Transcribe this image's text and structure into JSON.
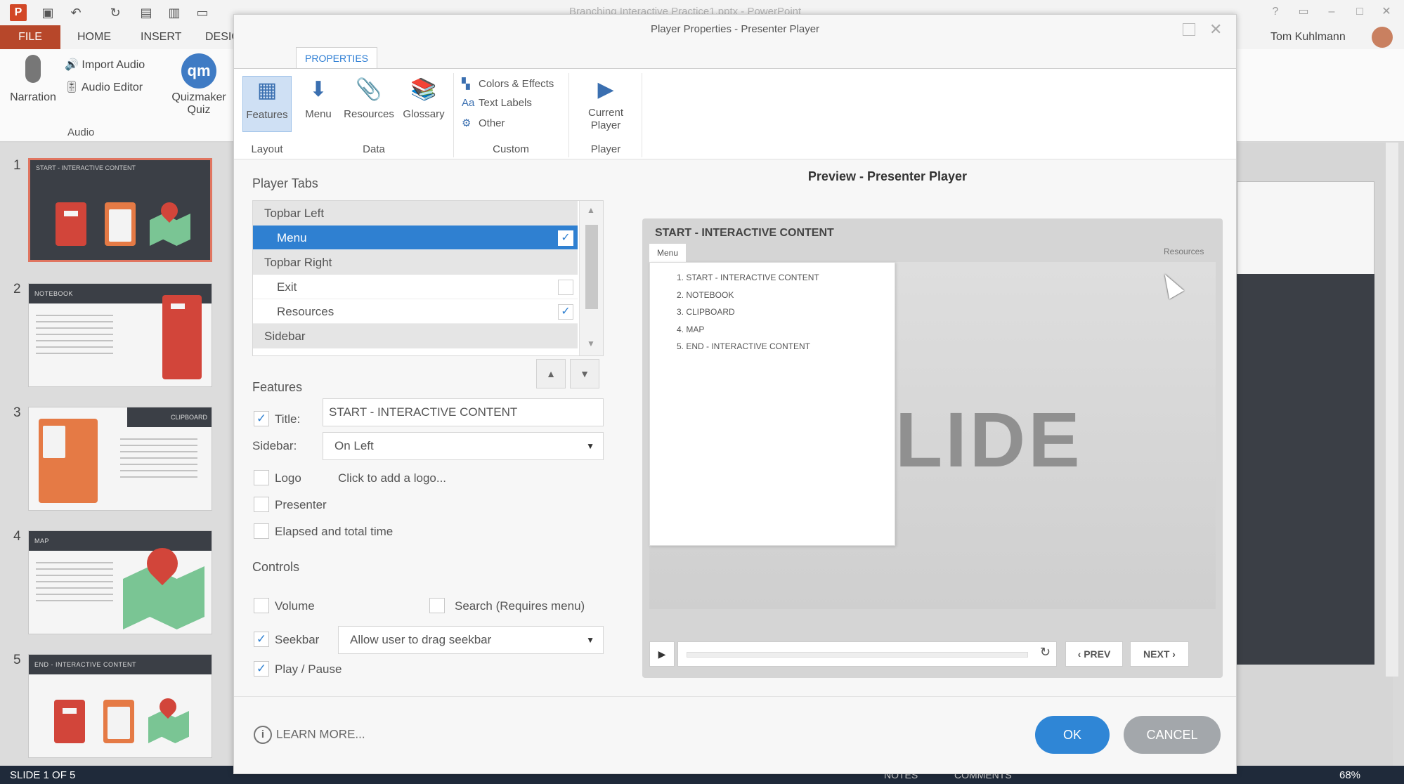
{
  "ppt": {
    "title": "Branching Interactive Practice1.pptx - PowerPoint",
    "file_tab": "FILE",
    "tabs": [
      "HOME",
      "INSERT",
      "DESIG"
    ],
    "user": "Tom Kuhlmann",
    "ribbon": {
      "narration": "Narration",
      "import_audio": "Import Audio",
      "audio_editor": "Audio Editor",
      "quizmaker_line1": "Quizmaker",
      "quizmaker_line2": "Quiz",
      "audio_group": "Audio",
      "qm_icon_text": "qm"
    },
    "thumbnails": [
      {
        "num": "1",
        "title": "START - INTERACTIVE CONTENT"
      },
      {
        "num": "2",
        "title": "NOTEBOOK"
      },
      {
        "num": "3",
        "title": "CLIPBOARD"
      },
      {
        "num": "4",
        "title": "MAP"
      },
      {
        "num": "5",
        "title": "END - INTERACTIVE CONTENT"
      }
    ],
    "status": {
      "slide": "SLIDE 1 OF 5",
      "notes": "NOTES",
      "comments": "COMMENTS",
      "zoom": "68%"
    }
  },
  "dialog": {
    "title": "Player Properties - Presenter Player",
    "ribbon_tab": "PROPERTIES",
    "ribbon": {
      "features": "Features",
      "menu": "Menu",
      "resources": "Resources",
      "glossary": "Glossary",
      "colors_effects": "Colors & Effects",
      "text_labels": "Text Labels",
      "other": "Other",
      "current_player_line1": "Current",
      "current_player_line2": "Player",
      "groups": {
        "layout": "Layout",
        "data": "Data",
        "custom": "Custom",
        "player": "Player"
      }
    },
    "player_tabs": {
      "label": "Player Tabs",
      "rows": [
        {
          "label": "Topbar Left",
          "type": "group"
        },
        {
          "label": "Menu",
          "type": "item",
          "checked": true,
          "selected": true
        },
        {
          "label": "Topbar Right",
          "type": "group"
        },
        {
          "label": "Exit",
          "type": "item",
          "checked": false
        },
        {
          "label": "Resources",
          "type": "item",
          "checked": true
        },
        {
          "label": "Sidebar",
          "type": "group"
        }
      ]
    },
    "features": {
      "label": "Features",
      "title_label": "Title:",
      "title_value": "START - INTERACTIVE CONTENT",
      "sidebar_label": "Sidebar:",
      "sidebar_value": "On Left",
      "logo_label": "Logo",
      "logo_placeholder": "Click to add a logo...",
      "presenter_label": "Presenter",
      "elapsed_label": "Elapsed and total time"
    },
    "controls": {
      "label": "Controls",
      "volume": "Volume",
      "search": "Search (Requires menu)",
      "seekbar": "Seekbar",
      "seekbar_option": "Allow user to drag seekbar",
      "play_pause": "Play / Pause"
    },
    "preview": {
      "title": "Preview - Presenter Player",
      "course_title": "START - INTERACTIVE CONTENT",
      "menu_tab": "Menu",
      "resources_tab": "Resources",
      "slide_word": "LIDE",
      "menu_items": [
        "1. START - INTERACTIVE CONTENT",
        "2. NOTEBOOK",
        "3. CLIPBOARD",
        "4. MAP",
        "5. END - INTERACTIVE CONTENT"
      ],
      "prev": "‹ PREV",
      "next": "NEXT ›"
    },
    "learn_more": "LEARN MORE...",
    "ok": "OK",
    "cancel": "CANCEL"
  },
  "colors": {
    "accent": "#2f80d1",
    "ppt_red": "#b7472a",
    "ok_button": "#2f86d6",
    "cancel_button": "#a3a7ab"
  }
}
